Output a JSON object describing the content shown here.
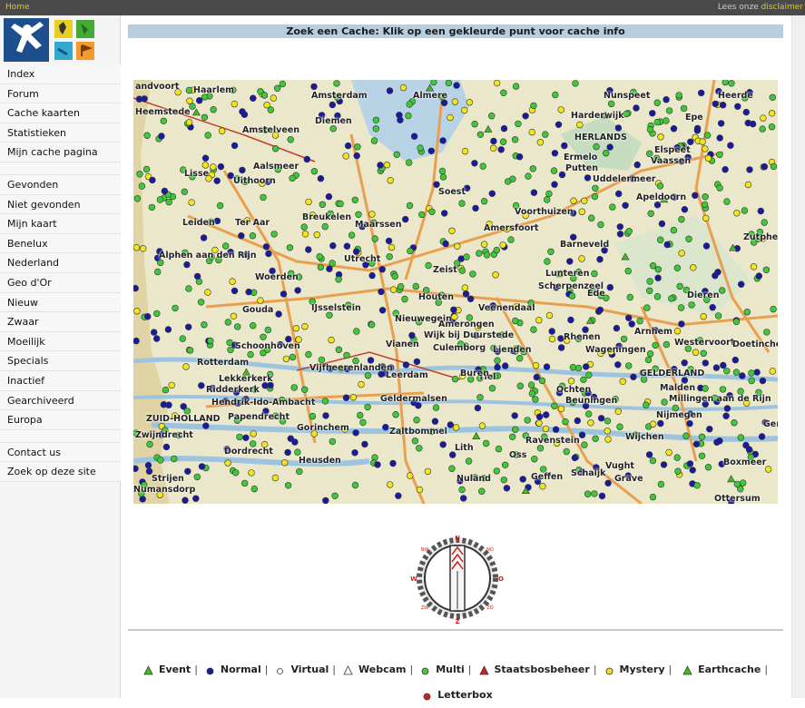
{
  "topbar": {
    "home": "Home",
    "prefix": "Lees onze ",
    "disclaimer": "disclaimer"
  },
  "sidebar": {
    "group1": [
      "Index",
      "Forum",
      "Cache kaarten",
      "Statistieken",
      "Mijn cache pagina"
    ],
    "group2": [
      "Gevonden",
      "Niet gevonden",
      "Mijn kaart",
      "Benelux",
      "Nederland",
      "Geo d'Or",
      "Nieuw",
      "Zwaar",
      "Moeilijk",
      "Specials",
      "Inactief",
      "Gearchiveerd",
      "Europa"
    ],
    "group3": [
      "Contact us",
      "Zoek op deze site"
    ]
  },
  "title": "Zoek een Cache: Klik op een gekleurde punt voor cache info",
  "map": {
    "labels": [
      "andvoort",
      "Haarlem",
      "Amsterdam",
      "Almere",
      "Nunspeet",
      "Heerde",
      "Heemstede",
      "Diemen",
      "Harderwijk",
      "Epe",
      "Amstelveen",
      "HERLANDS",
      "Aalsmeer",
      "Ermelo",
      "Putten",
      "Elspeet",
      "Vaassen",
      "Lisse",
      "Uithoorn",
      "Barneveld",
      "Apeldoorn",
      "Soest",
      "Amersfoort",
      "Voorthuizen",
      "Leiden",
      "Ter Aar",
      "Breukelen",
      "Maarssen",
      "Zeist",
      "Utrecht",
      "Woerden",
      "Houten",
      "Veenendaal",
      "Ede",
      "Arnhem",
      "Zutphen",
      "Alphen aan den Rijn",
      "Gouda",
      "IJsselstein",
      "Nieuwegein",
      "Wijk bij Duurstede",
      "Rhenen",
      "Wageningen",
      "Westervoort",
      "Dieren",
      "Schoonhoven",
      "Vianen",
      "Culemborg",
      "Tiel",
      "Lienden",
      "Doetinchem",
      "Rotterdam",
      "Ridderkerk",
      "Leerdam",
      "Geldermalsen",
      "Beuningen",
      "Nijmegen",
      "Dordrecht",
      "Gorinchem",
      "Zaltbommel",
      "Ravenstein",
      "Wijchen",
      "Oss",
      "Heusden",
      "Vught",
      "Schaijk",
      "Grave",
      "Strijen",
      "Numansdorp",
      "Geffen",
      "ZUID-HOLLAND",
      "GELDERLAND",
      "Uddelermeer",
      "Zwijndrecht",
      "Hendrik-Ido-Ambacht",
      "Papendrecht",
      "Lekkerkerk",
      "Vijfheerenlanden",
      "Buren",
      "Amerongen",
      "Scherpenzeel",
      "Lunteren",
      "Ochten",
      "Malden",
      "Millingen aan de Rijn",
      "Gennep",
      "Boxmeer",
      "Ottersum",
      "Lith",
      "Nuland"
    ]
  },
  "compass": {
    "n": "N",
    "s": "Z",
    "w": "W",
    "e": "O",
    "nw": "NW",
    "ne": "NO",
    "sw": "ZW",
    "se": "ZO"
  },
  "legend": [
    {
      "symbol": "triangle-green",
      "label": "Event",
      "color": "#44bb22"
    },
    {
      "symbol": "dot-blue",
      "label": "Normal",
      "color": "#1a1aa0"
    },
    {
      "symbol": "circle-white",
      "label": "Virtual",
      "color": "#ffffff"
    },
    {
      "symbol": "triangle-white",
      "label": "Webcam",
      "color": "#ffffff"
    },
    {
      "symbol": "dot-green",
      "label": "Multi",
      "color": "#44cc33"
    },
    {
      "symbol": "triangle-red",
      "label": "Staatsbosbeheer",
      "color": "#cc2222"
    },
    {
      "symbol": "dot-yellow",
      "label": "Mystery",
      "color": "#f0e020"
    },
    {
      "symbol": "triangle-green",
      "label": "Earthcache",
      "color": "#44bb22"
    },
    {
      "symbol": "dot-red",
      "label": "Letterbox",
      "color": "#cc2222"
    }
  ],
  "colors": {
    "accent": "#e8c800",
    "title_bar": "#b7cde0",
    "topbar": "#4a4a4a"
  }
}
